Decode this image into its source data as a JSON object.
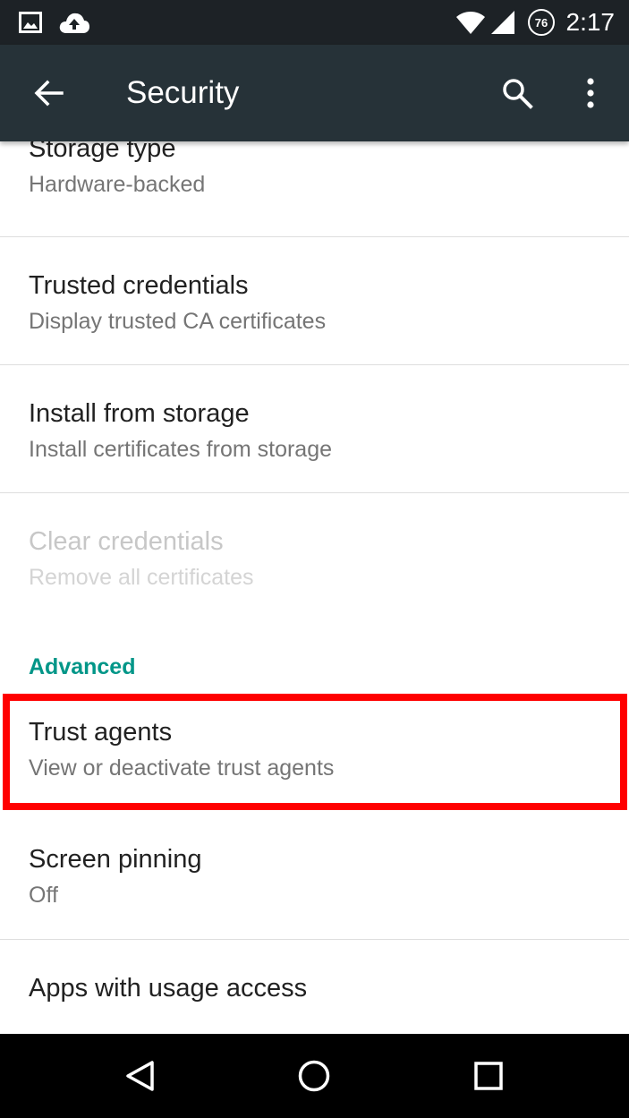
{
  "status_bar": {
    "time": "2:17",
    "battery_level": "76",
    "icons": [
      "image-icon",
      "cloud-upload-icon",
      "wifi-icon",
      "cell-signal-icon"
    ]
  },
  "toolbar": {
    "title": "Security",
    "icons": [
      "back-arrow-icon",
      "search-icon",
      "overflow-menu-icon"
    ],
    "background": "#263238"
  },
  "list": {
    "storage_type": {
      "title": "Storage type",
      "summary": "Hardware-backed"
    },
    "trusted_credentials": {
      "title": "Trusted credentials",
      "summary": "Display trusted CA certificates"
    },
    "install_from_storage": {
      "title": "Install from storage",
      "summary": "Install certificates from storage"
    },
    "clear_credentials": {
      "title": "Clear credentials",
      "summary": "Remove all certificates",
      "enabled": false
    },
    "advanced_header": "Advanced",
    "trust_agents": {
      "title": "Trust agents",
      "summary": "View or deactivate trust agents"
    },
    "screen_pinning": {
      "title": "Screen pinning",
      "summary": "Off"
    },
    "apps_usage_access": {
      "title": "Apps with usage access"
    }
  },
  "highlight": {
    "target": "trust_agents",
    "color": "#ff0000"
  },
  "colors": {
    "accent": "#009688",
    "status_bar": "#1d2226"
  },
  "nav_bar": {
    "icons": [
      "back-triangle-icon",
      "home-circle-icon",
      "recents-square-icon"
    ]
  }
}
